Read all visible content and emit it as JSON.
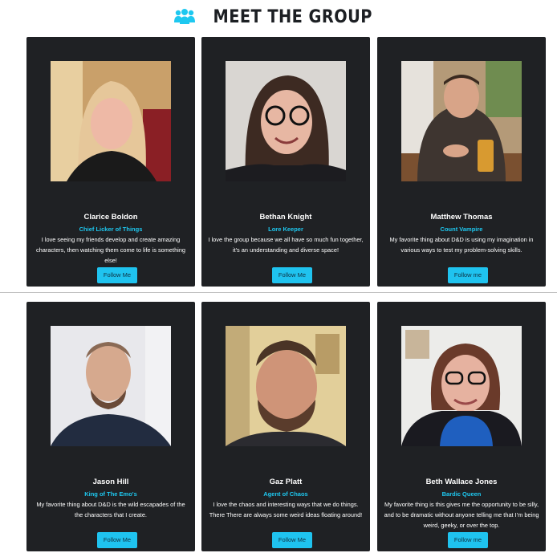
{
  "header": {
    "title": "MEET THE GROUP",
    "icon": "group-icon",
    "accent": "#1ec8f0"
  },
  "members": [
    {
      "name": "Clarice Boldon",
      "role": "Chief Licker of Things",
      "bio": "I love seeing my friends develop and create amazing characters, then watching them come to life is something else!",
      "button": "Follow Me"
    },
    {
      "name": "Bethan Knight",
      "role": "Lore Keeper",
      "bio": "I love the group because we all have so much fun together, it's an understanding and diverse space!",
      "button": "Follow Me"
    },
    {
      "name": "Matthew Thomas",
      "role": "Count Vampire",
      "bio": "My favorite thing about D&D is using my imagination in various ways to test my problem-solving skills.",
      "button": "Follow me"
    },
    {
      "name": "Jason Hill",
      "role": "King of The Emo's",
      "bio": "My favorite thing about D&D is the wild escapades of the the characters that I create.",
      "button": "Follow Me"
    },
    {
      "name": "Gaz Platt",
      "role": "Agent of Chaos",
      "bio": "I love the chaos and interesting ways that we do things. There There are always some weird ideas floating around!",
      "button": "Follow Me"
    },
    {
      "name": "Beth Wallace Jones",
      "role": "Bardic Queen",
      "bio": "My favorite thing is this gives me the opportunity to be silly, and to be dramatic without anyone telling me that I'm being weird, geeky, or over the top.",
      "button": "Follow me"
    }
  ]
}
